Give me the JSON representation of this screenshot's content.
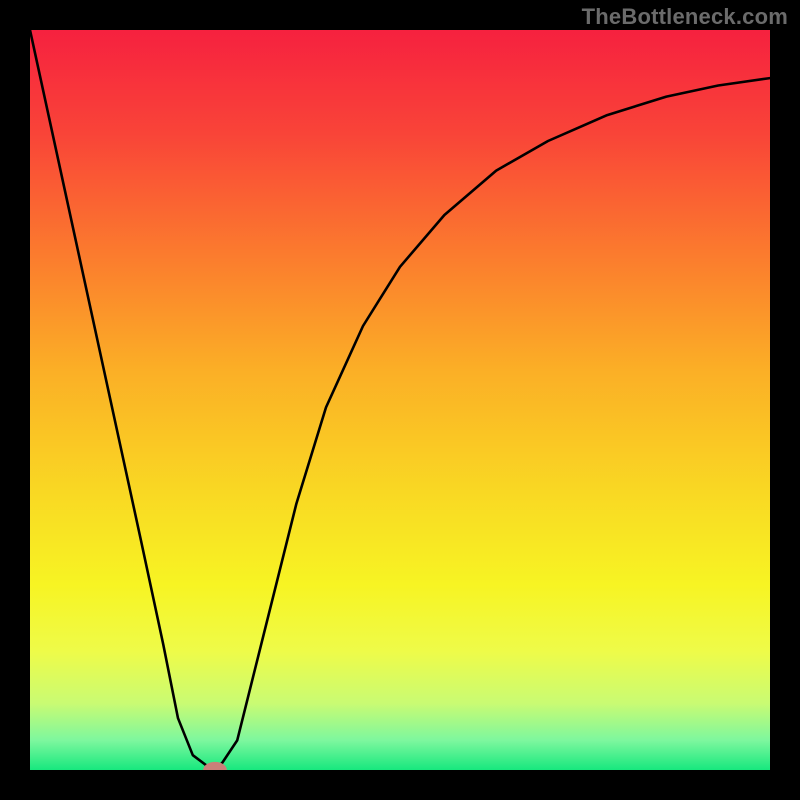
{
  "watermark": "TheBottleneck.com",
  "chart_data": {
    "type": "line",
    "title": "",
    "xlabel": "",
    "ylabel": "",
    "xlim": [
      0,
      100
    ],
    "ylim": [
      0,
      100
    ],
    "background_gradient": {
      "stops": [
        {
          "offset": 0,
          "color": "#f6213f"
        },
        {
          "offset": 14,
          "color": "#f94438"
        },
        {
          "offset": 30,
          "color": "#fb7a2e"
        },
        {
          "offset": 46,
          "color": "#fbaf26"
        },
        {
          "offset": 62,
          "color": "#f9d723"
        },
        {
          "offset": 75,
          "color": "#f7f423"
        },
        {
          "offset": 84,
          "color": "#eefb49"
        },
        {
          "offset": 91,
          "color": "#c9fb73"
        },
        {
          "offset": 96,
          "color": "#7df79e"
        },
        {
          "offset": 100,
          "color": "#17e87e"
        }
      ]
    },
    "curve": {
      "x": [
        0,
        5,
        10,
        15,
        18,
        20,
        22,
        24,
        25,
        26,
        28,
        30,
        33,
        36,
        40,
        45,
        50,
        56,
        63,
        70,
        78,
        86,
        93,
        100
      ],
      "y": [
        100,
        77,
        54,
        31,
        17,
        7,
        2,
        0.5,
        0,
        1,
        4,
        12,
        24,
        36,
        49,
        60,
        68,
        75,
        81,
        85,
        88.5,
        91,
        92.5,
        93.5
      ]
    },
    "marker": {
      "x": 25,
      "y": 0,
      "rx": 1.6,
      "ry": 1.1,
      "fill": "#c98079"
    }
  }
}
